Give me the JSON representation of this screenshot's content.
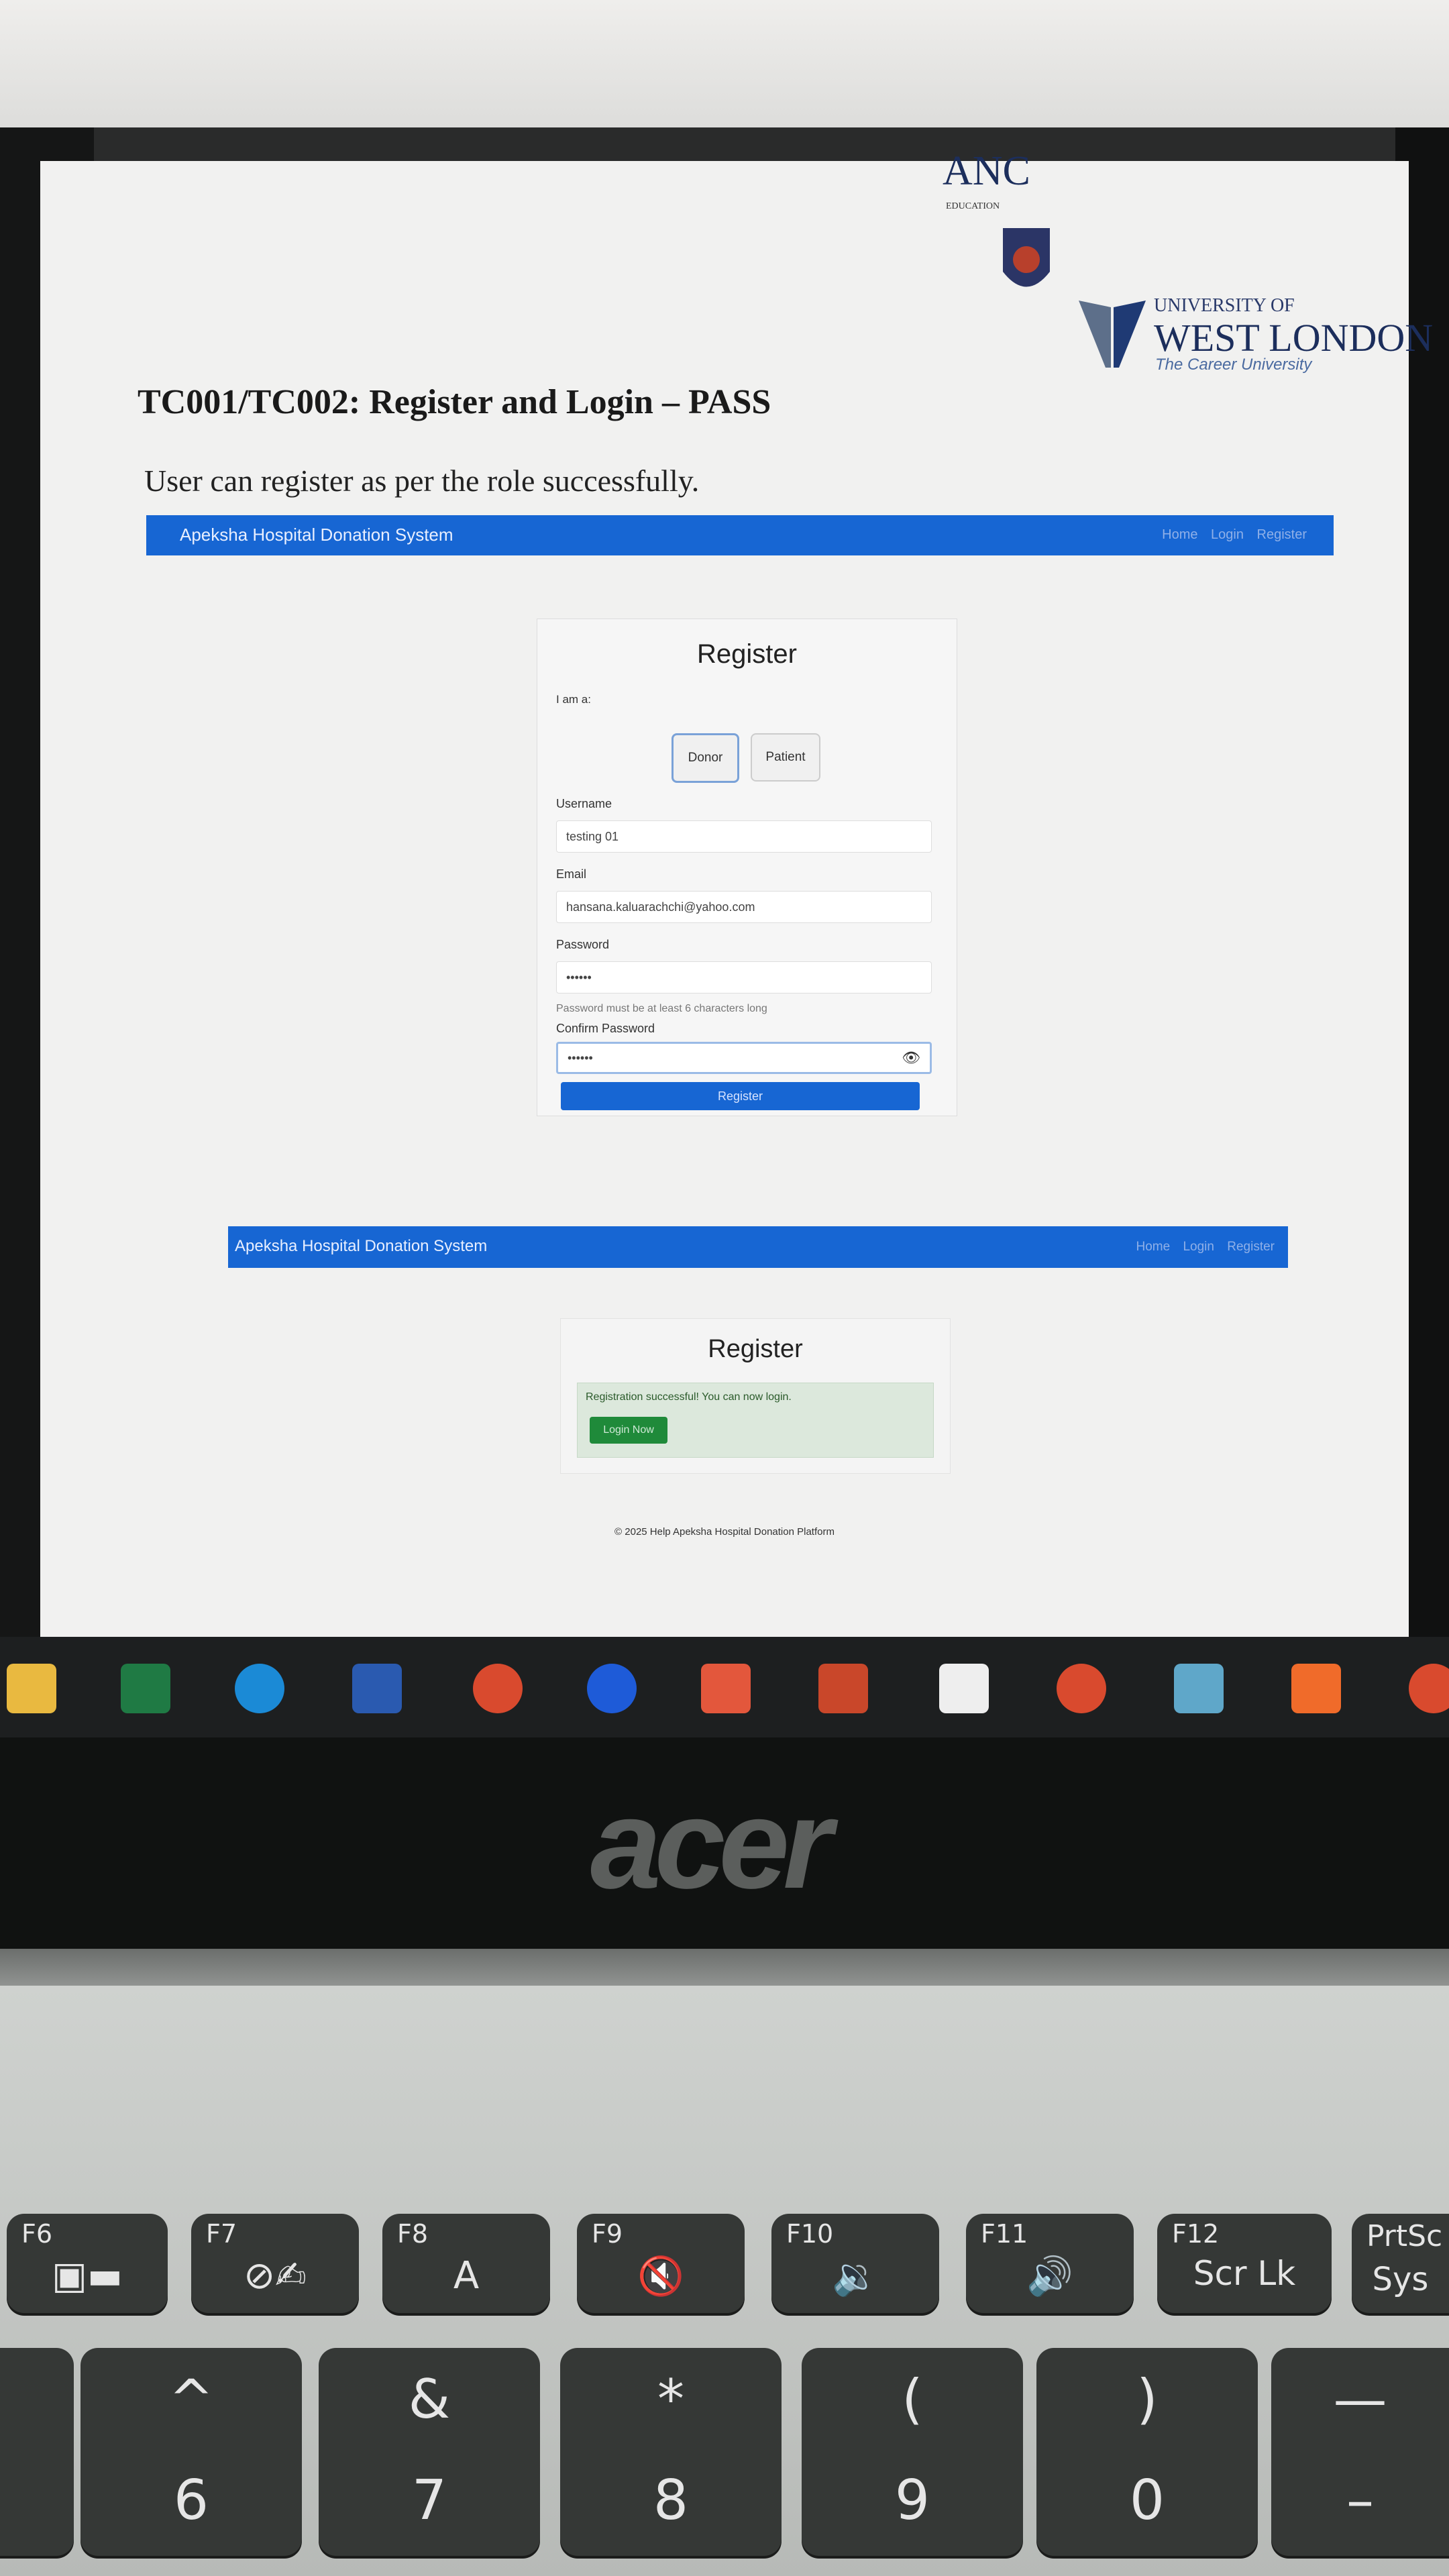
{
  "document": {
    "title": "TC001/TC002: Register and Login – PASS",
    "description": "User can register as per the role successfully."
  },
  "logo": {
    "anc_text": "ANC",
    "anc_sub": "EDUCATION",
    "university_top": "UNIVERSITY OF",
    "university_main": "WEST LONDON",
    "university_sub": "The Career University"
  },
  "screenshot1": {
    "brand": "Apeksha Hospital Donation System",
    "nav_links": "Home Login Register",
    "card_title": "Register",
    "role_label": "I am a:",
    "roles": [
      "Donor",
      "Patient"
    ],
    "selected_role": "Donor",
    "username_label": "Username",
    "username_value": "testing 01",
    "email_label": "Email",
    "email_value": "hansana.kaluarachchi@yahoo.com",
    "password_label": "Password",
    "password_value": "••••••",
    "password_help": "Password must be at least 6 characters long",
    "confirm_label": "Confirm Password",
    "confirm_value": "••••••",
    "submit_label": "Register"
  },
  "screenshot2": {
    "brand": "Apeksha Hospital Donation System",
    "nav_links": "Home Login Register",
    "card_title": "Register",
    "alert_text": "Registration successful! You can now login.",
    "login_button": "Login Now",
    "footer": "© 2025 Help Apeksha Hospital Donation Platform"
  },
  "laptop": {
    "brand_logo": "acer"
  },
  "keyboard": {
    "function_keys": [
      {
        "label": "F6",
        "glyph": "▣▬"
      },
      {
        "label": "F7",
        "glyph": "⊘✍"
      },
      {
        "label": "F8",
        "glyph": "A"
      },
      {
        "label": "F9",
        "glyph": "🔇"
      },
      {
        "label": "F10",
        "glyph": "🔉"
      },
      {
        "label": "F11",
        "glyph": "🔊"
      },
      {
        "label": "F12",
        "glyph": "Scr Lk"
      },
      {
        "label": "PrtSc",
        "glyph": "Sys"
      }
    ],
    "number_keys": [
      {
        "top": "^",
        "bottom": "6"
      },
      {
        "top": "&",
        "bottom": "7"
      },
      {
        "top": "*",
        "bottom": "8"
      },
      {
        "top": "(",
        "bottom": "9"
      },
      {
        "top": ")",
        "bottom": "0"
      },
      {
        "top": "—",
        "bottom": "–"
      }
    ]
  },
  "colors": {
    "navbar": "#1766d3",
    "success_alert": "#dce8dc",
    "login_button": "#1f8a3a"
  }
}
